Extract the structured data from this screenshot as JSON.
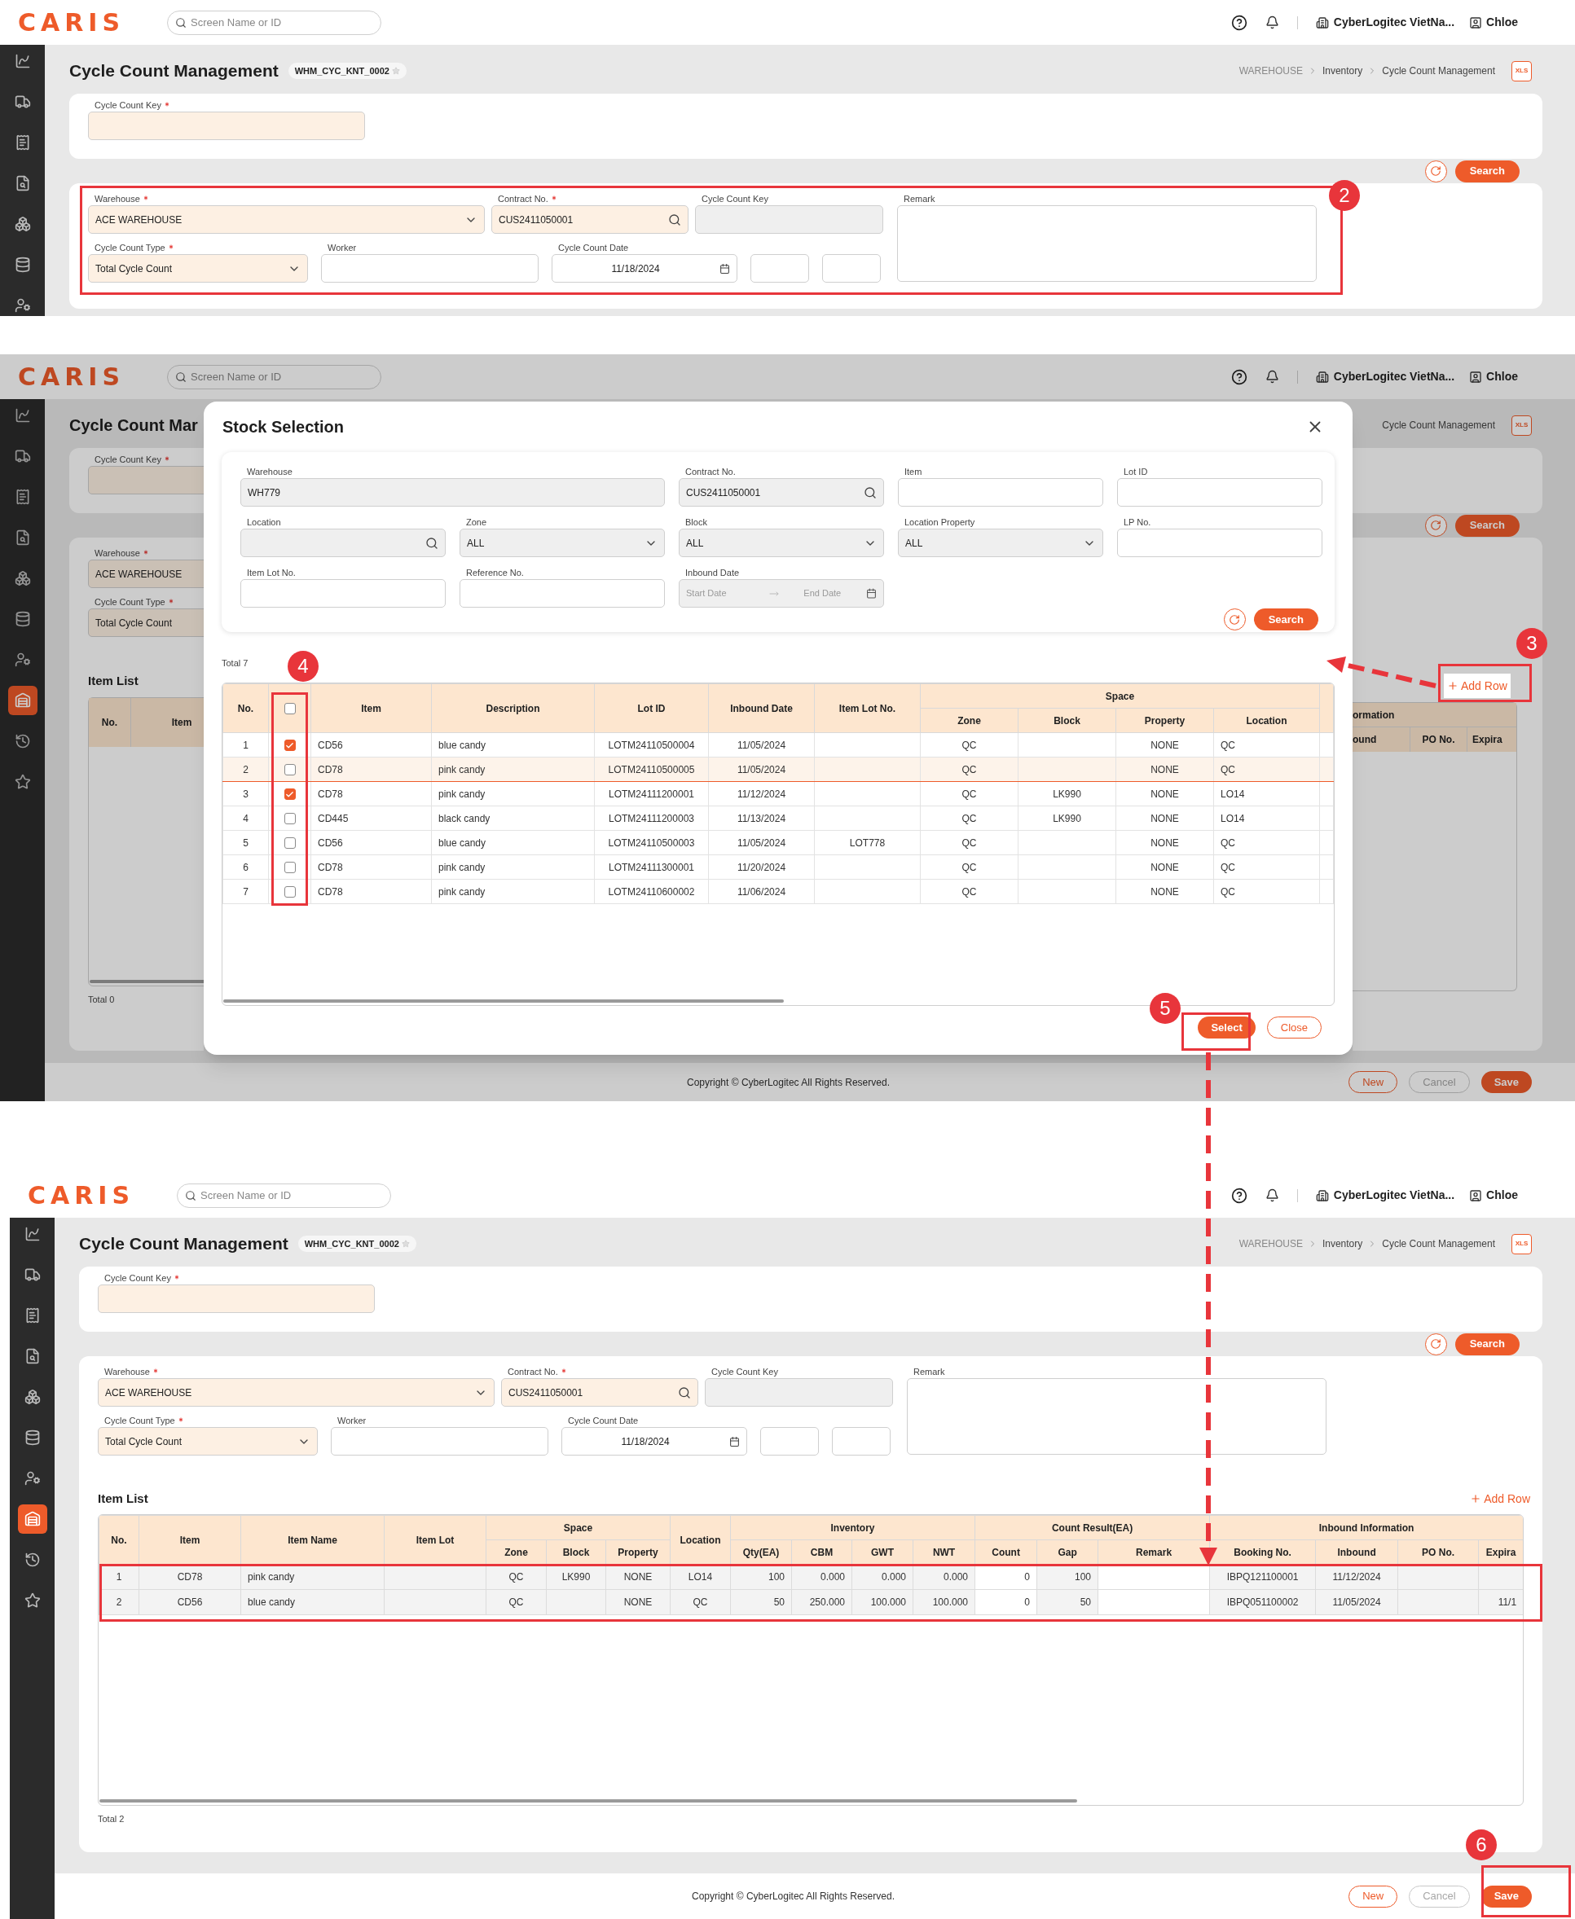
{
  "screen_1": {
    "header": {
      "logo": "CARIS",
      "search_placeholder": "Screen Name or ID",
      "company": "CyberLogitec VietNa...",
      "user": "Chloe"
    },
    "sidebar": {
      "items": [
        {
          "selected": false
        },
        {
          "selected": false
        },
        {
          "selected": false
        },
        {
          "selected": false
        },
        {
          "selected": false
        },
        {
          "selected": false
        },
        {
          "selected": false
        }
      ]
    },
    "page": {
      "title": "Cycle Count Management",
      "screen_id": "WHM_CYC_KNT_0002",
      "breadcrumb": [
        "WAREHOUSE",
        "Inventory",
        "Cycle Count Management"
      ],
      "export_label": "XLS",
      "key_field": {
        "label": "Cycle Count Key",
        "required": true,
        "kind": "text",
        "disabled": false
      },
      "search_button": "Search",
      "form": [
        {
          "label": "Warehouse",
          "required": true,
          "kind": "select",
          "value": "ACE WAREHOUSE",
          "disabled": false
        },
        {
          "label": "Contract No.",
          "required": true,
          "kind": "search",
          "value": "CUS2411050001",
          "disabled": false
        },
        {
          "label": "Cycle Count Key",
          "required": false,
          "kind": "text",
          "disabled": true
        },
        {
          "label": "Remark",
          "required": false,
          "kind": "textarea",
          "disabled": false
        },
        {
          "label": "Cycle Count Type",
          "required": true,
          "kind": "select",
          "value": "Total Cycle Count",
          "disabled": false
        },
        {
          "label": "Worker",
          "required": false,
          "kind": "text",
          "disabled": false
        },
        {
          "label": "Cycle Count Date",
          "required": false,
          "kind": "date",
          "value": "11/18/2024",
          "disabled": false
        },
        {
          "required": false,
          "kind": "text",
          "disabled": false
        },
        {
          "required": false,
          "kind": "text",
          "disabled": false
        }
      ]
    },
    "annotations": [
      {
        "number": "2"
      }
    ]
  },
  "screen_2": {
    "header": {
      "logo": "CARIS",
      "search_placeholder": "Screen Name or ID",
      "company": "CyberLogitec VietNa...",
      "user": "Chloe"
    },
    "sidebar": {
      "items": [
        {
          "selected": false
        },
        {
          "selected": false
        },
        {
          "selected": false
        },
        {
          "selected": false
        },
        {
          "selected": false
        },
        {
          "selected": false
        },
        {
          "selected": false
        },
        {
          "selected": true
        },
        {
          "selected": false
        },
        {
          "selected": false
        }
      ]
    },
    "background": {
      "title": "Cycle Count Mar",
      "key_field": {
        "label": "Cycle Count Key",
        "required": true,
        "kind": "text"
      },
      "warehouse_field": {
        "label": "Warehouse",
        "required": true,
        "kind": "text",
        "value": "ACE WAREHOUSE",
        "disabled": false
      },
      "type_field": {
        "label": "Cycle Count Type",
        "required": true,
        "kind": "text",
        "value": "Total Cycle Count",
        "disabled": false
      },
      "item_list_title": "Item List",
      "left_columns": [
        "No.",
        "Item"
      ],
      "right_group": "ormation",
      "right_columns": [
        "ound",
        "PO No.",
        "Expira"
      ],
      "total": "Total 0",
      "breadcrumb": [
        "Cycle Count Management"
      ],
      "export_label": "XLS",
      "search_button": "Search",
      "copyright": "Copyright © CyberLogitec All Rights Reserved.",
      "buttons": [
        {
          "label": "New",
          "kind": "outline",
          "disabled": false
        },
        {
          "label": "Cancel",
          "kind": "outline",
          "disabled": true
        },
        {
          "label": "Save",
          "kind": "primary",
          "disabled": false
        }
      ]
    },
    "add_row": "Add Row",
    "modal": {
      "title": "Stock Selection",
      "filters": [
        {
          "label": "Warehouse",
          "required": false,
          "kind": "text",
          "value": "WH779",
          "disabled": true
        },
        {
          "label": "Contract No.",
          "required": false,
          "kind": "search",
          "value": "CUS2411050001",
          "disabled": true
        },
        {
          "label": "Item",
          "required": false,
          "kind": "text",
          "disabled": false
        },
        {
          "label": "Lot ID",
          "required": false,
          "kind": "text",
          "disabled": false
        },
        {
          "label": "Location",
          "required": false,
          "kind": "search",
          "disabled": true
        },
        {
          "label": "Zone",
          "required": false,
          "kind": "select",
          "value": "ALL",
          "disabled": true
        },
        {
          "label": "Block",
          "required": false,
          "kind": "select",
          "value": "ALL",
          "disabled": true
        },
        {
          "label": "Location Property",
          "required": false,
          "kind": "select",
          "value": "ALL",
          "disabled": true
        },
        {
          "label": "LP No.",
          "required": false,
          "kind": "text",
          "disabled": false
        },
        {
          "label": "Item Lot No.",
          "required": false,
          "kind": "text",
          "disabled": false
        },
        {
          "label": "Reference No.",
          "required": false,
          "kind": "text",
          "disabled": false
        },
        {
          "label": "Inbound Date",
          "required": false,
          "kind": "date_range",
          "placeholder": "Start Date",
          "end_placeholder": "End Date",
          "disabled": true
        }
      ],
      "search_button": "Search",
      "total": "Total 7",
      "table": {
        "columns": [
          {
            "label": "No."
          },
          {
            "kind": "checkbox",
            "checked": false
          },
          {
            "label": "Item"
          },
          {
            "label": "Description"
          },
          {
            "label": "Lot ID"
          },
          {
            "label": "Inbound Date"
          },
          {
            "label": "Item Lot No."
          },
          {
            "label": "Space",
            "colspan": 4,
            "children": [
              {
                "label": "Zone"
              },
              {
                "label": "Block"
              },
              {
                "label": "Property"
              },
              {
                "label": "Location"
              }
            ]
          }
        ],
        "rows": [
          {
            "checked": true,
            "highlighted": false,
            "cells": [
              "1",
              null,
              "CD56",
              "blue candy",
              "LOTM24110500004",
              "11/05/2024",
              null,
              "QC",
              null,
              "NONE",
              "QC"
            ]
          },
          {
            "checked": false,
            "highlighted": true,
            "cells": [
              "2",
              null,
              "CD78",
              "pink candy",
              "LOTM24110500005",
              "11/05/2024",
              null,
              "QC",
              null,
              "NONE",
              "QC"
            ]
          },
          {
            "checked": true,
            "highlighted": false,
            "cells": [
              "3",
              null,
              "CD78",
              "pink candy",
              "LOTM24111200001",
              "11/12/2024",
              null,
              "QC",
              "LK990",
              "NONE",
              "LO14"
            ]
          },
          {
            "checked": false,
            "highlighted": false,
            "cells": [
              "4",
              null,
              "CD445",
              "black candy",
              "LOTM24111200003",
              "11/13/2024",
              null,
              "QC",
              "LK990",
              "NONE",
              "LO14"
            ]
          },
          {
            "checked": false,
            "highlighted": false,
            "cells": [
              "5",
              null,
              "CD56",
              "blue candy",
              "LOTM24110500003",
              "11/05/2024",
              "LOT778",
              "QC",
              null,
              "NONE",
              "QC"
            ]
          },
          {
            "checked": false,
            "highlighted": false,
            "cells": [
              "6",
              null,
              "CD78",
              "pink candy",
              "LOTM24111300001",
              "11/20/2024",
              null,
              "QC",
              null,
              "NONE",
              "QC"
            ]
          },
          {
            "checked": false,
            "highlighted": false,
            "cells": [
              "7",
              null,
              "CD78",
              "pink candy",
              "LOTM24110600002",
              "11/06/2024",
              null,
              "QC",
              null,
              "NONE",
              "QC"
            ]
          }
        ]
      },
      "buttons": [
        {
          "label": "Select",
          "kind": "primary",
          "disabled": false
        },
        {
          "label": "Close",
          "kind": "outline",
          "disabled": false
        }
      ]
    },
    "annotations": [
      {
        "number": "3"
      },
      {
        "number": "4"
      },
      {
        "number": "5"
      }
    ]
  },
  "screen_3": {
    "header": {
      "logo": "CARIS",
      "search_placeholder": "Screen Name or ID",
      "company": "CyberLogitec VietNa...",
      "user": "Chloe"
    },
    "sidebar": {
      "items": [
        {
          "selected": false
        },
        {
          "selected": false
        },
        {
          "selected": false
        },
        {
          "selected": false
        },
        {
          "selected": false
        },
        {
          "selected": false
        },
        {
          "selected": false
        },
        {
          "selected": true
        },
        {
          "selected": false
        },
        {
          "selected": false
        }
      ]
    },
    "page": {
      "title": "Cycle Count Management",
      "screen_id": "WHM_CYC_KNT_0002",
      "breadcrumb": [
        "WAREHOUSE",
        "Inventory",
        "Cycle Count Management"
      ],
      "export_label": "XLS",
      "key_field": {
        "label": "Cycle Count Key",
        "required": true,
        "kind": "text",
        "disabled": false
      },
      "search_button": "Search",
      "form": [
        {
          "label": "Warehouse",
          "required": true,
          "kind": "select",
          "value": "ACE WAREHOUSE",
          "disabled": false
        },
        {
          "label": "Contract No.",
          "required": true,
          "kind": "search",
          "value": "CUS2411050001",
          "disabled": false
        },
        {
          "label": "Cycle Count Key",
          "required": false,
          "kind": "text",
          "disabled": true
        },
        {
          "label": "Remark",
          "required": false,
          "kind": "textarea",
          "disabled": false
        },
        {
          "label": "Cycle Count Type",
          "required": true,
          "kind": "select",
          "value": "Total Cycle Count",
          "disabled": false
        },
        {
          "label": "Worker",
          "required": false,
          "kind": "text",
          "disabled": false
        },
        {
          "label": "Cycle Count Date",
          "required": false,
          "kind": "date",
          "value": "11/18/2024",
          "disabled": false
        },
        {
          "required": false,
          "kind": "text",
          "disabled": false
        },
        {
          "required": false,
          "kind": "text",
          "disabled": false
        }
      ]
    },
    "item_list": {
      "title": "Item List",
      "add_row": "Add Row",
      "total": "Total 2",
      "table": {
        "columns": [
          {
            "label": "No."
          },
          {
            "label": "Item"
          },
          {
            "label": "Item Name"
          },
          {
            "label": "Item Lot"
          },
          {
            "label": "Space",
            "colspan": 3,
            "children": [
              {
                "label": "Zone"
              },
              {
                "label": "Block"
              },
              {
                "label": "Property"
              }
            ]
          },
          {
            "label": "Location"
          },
          {
            "label": "Inventory",
            "colspan": 4,
            "children": [
              {
                "label": "Qty(EA)"
              },
              {
                "label": "CBM"
              },
              {
                "label": "GWT"
              },
              {
                "label": "NWT"
              }
            ]
          },
          {
            "label": "Count Result(EA)",
            "colspan": 3,
            "children": [
              {
                "label": "Count"
              },
              {
                "label": "Gap"
              },
              {
                "label": "Remark"
              }
            ]
          },
          {
            "label": "Inbound Information",
            "colspan": 4,
            "children": [
              {
                "label": "Booking No."
              },
              {
                "label": "Inbound"
              },
              {
                "label": "PO No."
              },
              {
                "label": "Expira"
              }
            ]
          }
        ],
        "rows": [
          {
            "cells": [
              "1",
              "CD78",
              "pink candy",
              null,
              "QC",
              "LK990",
              "NONE",
              "LO14",
              "100",
              "0.000",
              "0.000",
              "0.000",
              "0",
              "100",
              null,
              "IBPQ121100001",
              "11/12/2024",
              null,
              null
            ]
          },
          {
            "cells": [
              "2",
              "CD56",
              "blue candy",
              null,
              "QC",
              null,
              "NONE",
              "QC",
              "50",
              "250.000",
              "100.000",
              "100.000",
              "0",
              "50",
              null,
              "IBPQ051100002",
              "11/05/2024",
              null,
              "11/1"
            ]
          }
        ]
      }
    },
    "footer": {
      "copyright": "Copyright © CyberLogitec All Rights Reserved.",
      "buttons": [
        {
          "label": "New",
          "kind": "outline",
          "disabled": false
        },
        {
          "label": "Cancel",
          "kind": "outline",
          "disabled": true
        },
        {
          "label": "Save",
          "kind": "primary",
          "disabled": false
        }
      ]
    },
    "annotations": [
      {
        "number": "6"
      }
    ]
  }
}
